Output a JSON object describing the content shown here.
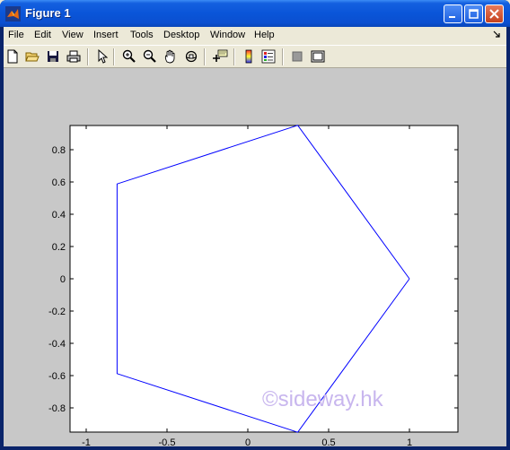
{
  "window": {
    "title": "Figure 1",
    "controls": {
      "minimize": "minimize-icon",
      "maximize": "maximize-icon",
      "close": "close-icon"
    }
  },
  "menu": {
    "items": [
      "File",
      "Edit",
      "View",
      "Insert",
      "Tools",
      "Desktop",
      "Window",
      "Help"
    ]
  },
  "toolbar": {
    "icons": [
      "new-figure-icon",
      "open-file-icon",
      "save-icon",
      "print-icon",
      "edit-plot-arrow-icon",
      "zoom-in-icon",
      "zoom-out-icon",
      "pan-hand-icon",
      "rotate-3d-icon",
      "data-cursor-icon",
      "insert-colorbar-icon",
      "insert-legend-icon",
      "hide-plot-tools-icon",
      "show-plot-tools-icon"
    ]
  },
  "watermark": "©sideway.hk",
  "colors": {
    "line": "#0000ff",
    "axes_bg": "#ffffff",
    "figure_bg": "#c8c8c8"
  },
  "chart_data": {
    "type": "line",
    "title": "",
    "xlabel": "",
    "ylabel": "",
    "xlim": [
      -1.1,
      1.3
    ],
    "ylim": [
      -0.95,
      0.95
    ],
    "xticks": [
      -1,
      -0.5,
      0,
      0.5,
      1
    ],
    "xtick_labels": [
      "-1",
      "-0.5",
      "0",
      "0.5",
      "1"
    ],
    "yticks": [
      0.8,
      0.6,
      0.4,
      0.2,
      0,
      -0.2,
      -0.4,
      -0.6,
      -0.8
    ],
    "ytick_labels": [
      "0.8",
      "0.6",
      "0.4",
      "0.2",
      "0",
      "-0.2",
      "-0.4",
      "-0.6",
      "-0.8"
    ],
    "grid": false,
    "series": [
      {
        "x": [
          1,
          0.309,
          -0.809,
          -0.809,
          0.309,
          1
        ],
        "y": [
          0,
          0.951,
          0.588,
          -0.588,
          -0.951,
          0
        ]
      }
    ]
  }
}
